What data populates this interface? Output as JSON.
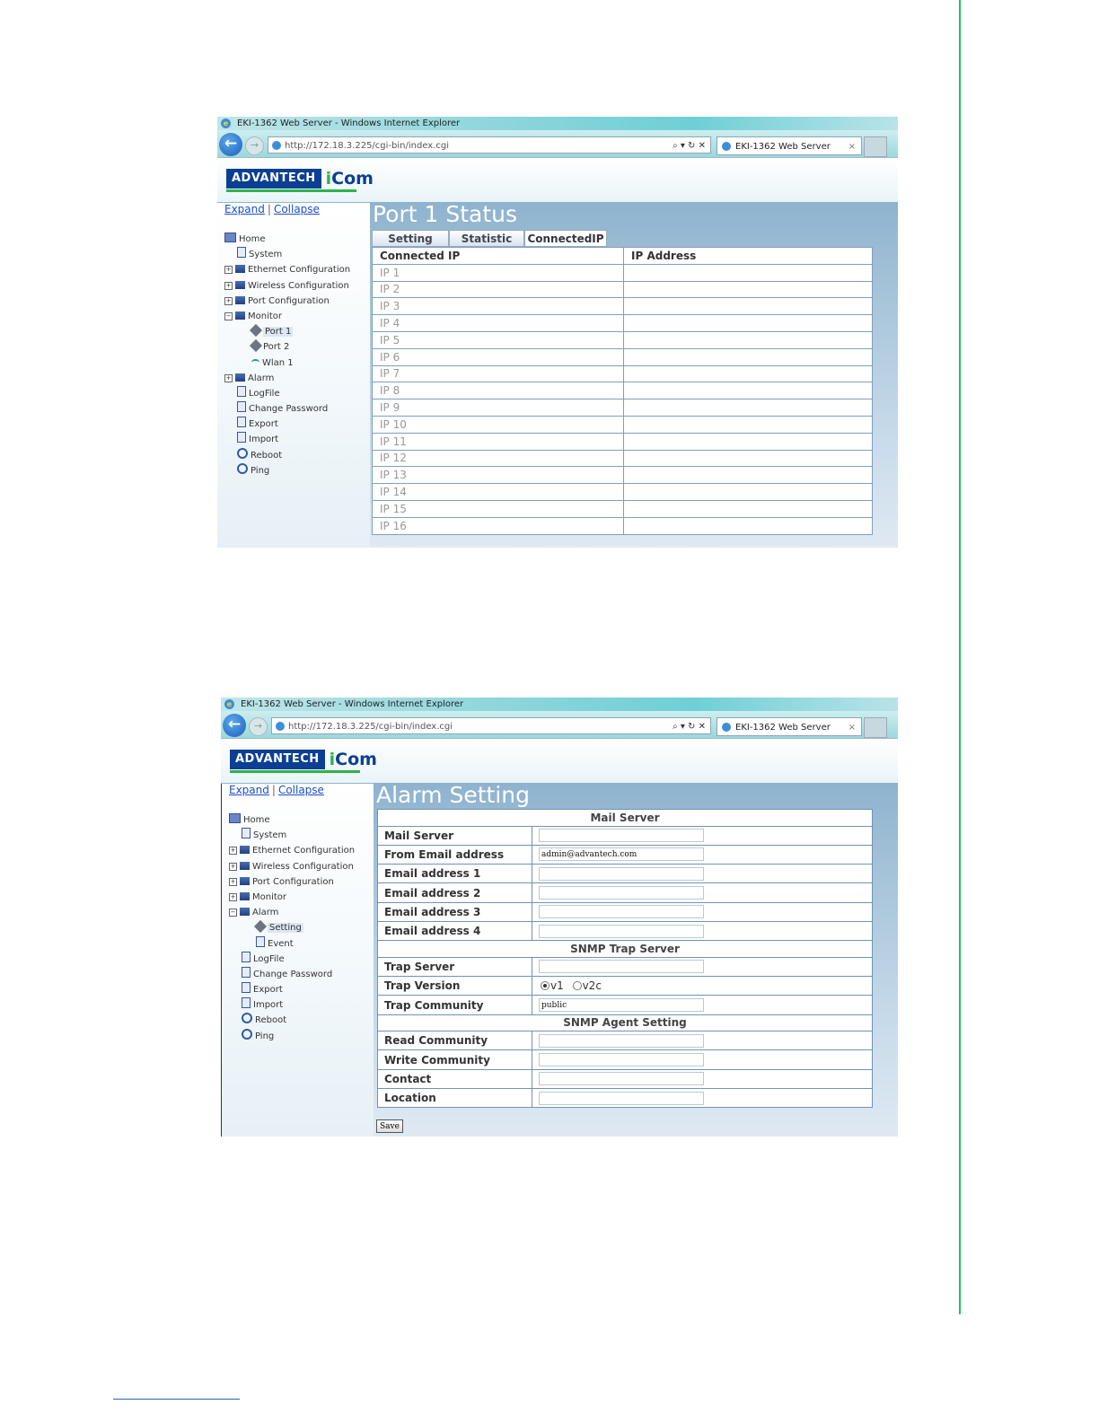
{
  "browser": {
    "window_title": "EKI-1362 Web Server - Windows Internet Explorer",
    "url": "http://172.18.3.225/cgi-bin/index.cgi",
    "tab_title": "EKI-1362 Web Server",
    "tab_close": "×",
    "address_tools": "⌕ ▾ ↻ ✕",
    "back_glyph": "←",
    "forward_glyph": "→"
  },
  "brand": {
    "advantech": "ADVANTECH",
    "icom_i": "i",
    "icom_rest": "Com"
  },
  "sidebar_links": {
    "expand": "Expand",
    "sep": "|",
    "collapse": "Collapse"
  },
  "screen1": {
    "page_title": "Port 1 Status",
    "tree": [
      {
        "label": "Home"
      },
      {
        "label": "System"
      },
      {
        "label": "Ethernet Configuration"
      },
      {
        "label": "Wireless Configuration"
      },
      {
        "label": "Port Configuration"
      },
      {
        "label": "Monitor"
      },
      {
        "label": "Port 1"
      },
      {
        "label": "Port 2"
      },
      {
        "label": "Wlan 1"
      },
      {
        "label": "Alarm"
      },
      {
        "label": "LogFile"
      },
      {
        "label": "Change Password"
      },
      {
        "label": "Export"
      },
      {
        "label": "Import"
      },
      {
        "label": "Reboot"
      },
      {
        "label": "Ping"
      }
    ],
    "tabs": [
      "Setting",
      "Statistic",
      "ConnectedIP"
    ],
    "table_headers": [
      "Connected IP",
      "IP Address"
    ],
    "rows": [
      "IP 1",
      "IP 2",
      "IP 3",
      "IP 4",
      "IP 5",
      "IP 6",
      "IP 7",
      "IP 8",
      "IP 9",
      "IP 10",
      "IP 11",
      "IP 12",
      "IP 13",
      "IP 14",
      "IP 15",
      "IP 16"
    ]
  },
  "screen2": {
    "page_title": "Alarm Setting",
    "tree": [
      {
        "label": "Home"
      },
      {
        "label": "System"
      },
      {
        "label": "Ethernet Configuration"
      },
      {
        "label": "Wireless Configuration"
      },
      {
        "label": "Port Configuration"
      },
      {
        "label": "Monitor"
      },
      {
        "label": "Alarm"
      },
      {
        "label": "Setting"
      },
      {
        "label": "Event"
      },
      {
        "label": "LogFile"
      },
      {
        "label": "Change Password"
      },
      {
        "label": "Export"
      },
      {
        "label": "Import"
      },
      {
        "label": "Reboot"
      },
      {
        "label": "Ping"
      }
    ],
    "sections": {
      "mail_server": "Mail Server",
      "snmp_trap": "SNMP Trap Server",
      "snmp_agent": "SNMP Agent Setting"
    },
    "fields": {
      "mail_server": {
        "label": "Mail Server",
        "value": ""
      },
      "from_email": {
        "label": "From Email address",
        "value": "admin@advantech.com"
      },
      "email1": {
        "label": "Email address 1",
        "value": ""
      },
      "email2": {
        "label": "Email address 2",
        "value": ""
      },
      "email3": {
        "label": "Email address 3",
        "value": ""
      },
      "email4": {
        "label": "Email address 4",
        "value": ""
      },
      "trap_server": {
        "label": "Trap Server",
        "value": ""
      },
      "trap_version": {
        "label": "Trap Version",
        "options": [
          "v1",
          "v2c"
        ],
        "selected": "v1"
      },
      "trap_community": {
        "label": "Trap Community",
        "value": "public"
      },
      "read_community": {
        "label": "Read Community",
        "value": ""
      },
      "write_community": {
        "label": "Write Community",
        "value": ""
      },
      "contact": {
        "label": "Contact",
        "value": ""
      },
      "location": {
        "label": "Location",
        "value": ""
      }
    },
    "save_label": "Save"
  },
  "colors": {
    "page_accent_line": "#22c55e",
    "brand_blue": "#0b3f93",
    "brand_green": "#2db34a"
  }
}
